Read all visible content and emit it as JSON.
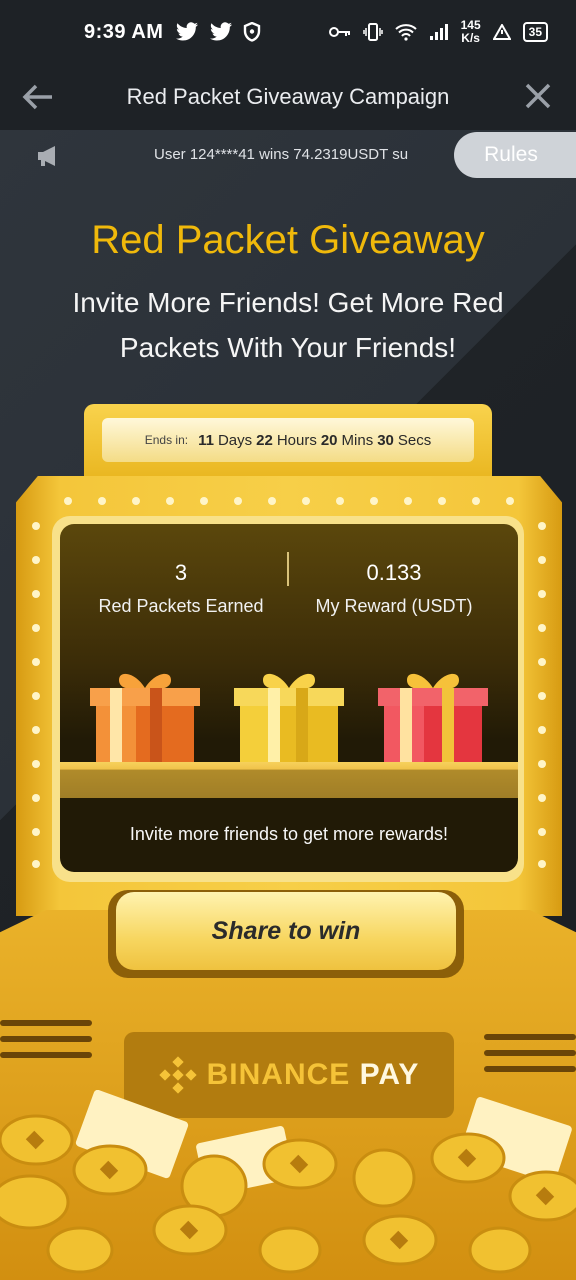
{
  "status_bar": {
    "time": "9:39 AM",
    "net_speed_value": "145",
    "net_speed_unit": "K/s",
    "battery": "35"
  },
  "header": {
    "title": "Red Packet Giveaway Campaign"
  },
  "ticker": {
    "text": "User 124****41 wins 74.2319USDT su"
  },
  "rules_button": "Rules",
  "hero": {
    "title": "Red Packet Giveaway",
    "subtitle": "Invite More Friends! Get More Red Packets With Your Friends!"
  },
  "countdown": {
    "prefix": "Ends in:",
    "days": "11",
    "days_label": "Days",
    "hours": "22",
    "hours_label": "Hours",
    "mins": "20",
    "mins_label": "Mins",
    "secs": "30",
    "secs_label": "Secs"
  },
  "stats": {
    "earned_value": "3",
    "earned_label": "Red Packets Earned",
    "reward_value": "0.133",
    "reward_label": "My Reward (USDT)"
  },
  "invite_text": "Invite more friends to get more rewards!",
  "share_button": "Share to win",
  "pay": {
    "brand": "BINANCE",
    "product": "PAY"
  },
  "colors": {
    "accent": "#f0b90b",
    "background": "#1e2226",
    "gift_orange": "#f07a2a",
    "gift_yellow": "#f3cd3a",
    "gift_red": "#ef4a4f"
  }
}
